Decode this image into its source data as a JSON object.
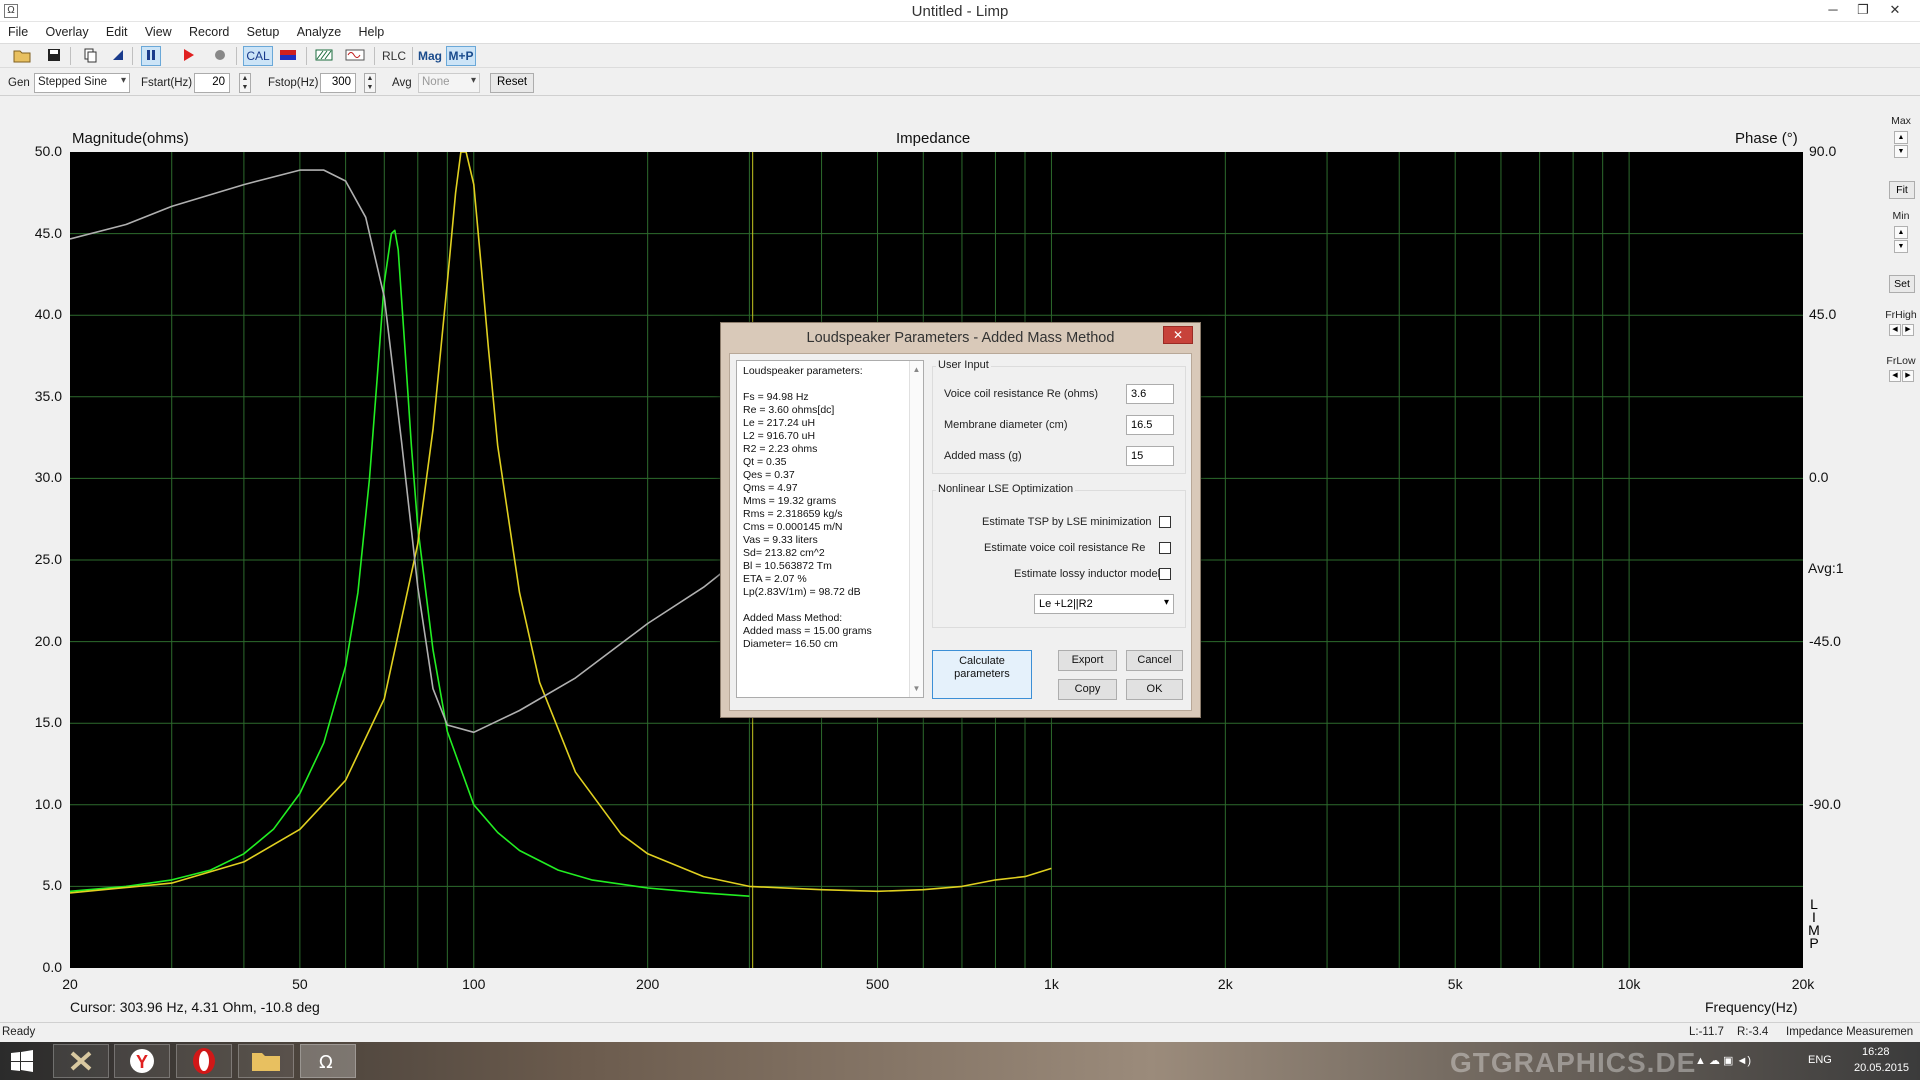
{
  "window": {
    "title": "Untitled - Limp",
    "app_icon": "Ω"
  },
  "menu": [
    "File",
    "Overlay",
    "Edit",
    "View",
    "Record",
    "Setup",
    "Analyze",
    "Help"
  ],
  "toolbar": {
    "cal": "CAL",
    "rlc": "RLC",
    "mag": "Mag",
    "mp": "M+P"
  },
  "genbar": {
    "gen_label": "Gen",
    "gen_value": "Stepped Sine",
    "fstart_label": "Fstart(Hz)",
    "fstart_value": "20",
    "fstop_label": "Fstop(Hz)",
    "fstop_value": "300",
    "avg_label": "Avg",
    "avg_value": "None",
    "reset": "Reset"
  },
  "plot": {
    "left_title": "Magnitude(ohms)",
    "center_title": "Impedance",
    "right_title": "Phase (°)",
    "x_title": "Frequency(Hz)",
    "cursor": "Cursor: 303.96 Hz, 4.31 Ohm, -10.8 deg",
    "avg": "Avg:1",
    "limp_v": [
      "L",
      "I",
      "M",
      "P"
    ]
  },
  "chart_data": {
    "type": "line",
    "title": "Impedance",
    "xlabel": "Frequency(Hz)",
    "ylabel": "Magnitude(ohms)",
    "y2label": "Phase (°)",
    "x_scale": "log",
    "xlim": [
      20,
      20000
    ],
    "ylim": [
      0,
      50
    ],
    "y2lim": [
      -135,
      90
    ],
    "grid": true,
    "x_ticks": [
      "20",
      "50",
      "100",
      "200",
      "500",
      "1k",
      "2k",
      "5k",
      "10k",
      "20k"
    ],
    "y_ticks": [
      "0.0",
      "5.0",
      "10.0",
      "15.0",
      "20.0",
      "25.0",
      "30.0",
      "35.0",
      "40.0",
      "45.0",
      "50.0"
    ],
    "y2_ticks": [
      "90.0",
      "45.0",
      "0.0",
      "-45.0",
      "-90.0"
    ],
    "cursor_x": 303.96,
    "series": [
      {
        "color": "#22ee22",
        "x": [
          20,
          25,
          30,
          35,
          40,
          45,
          50,
          55,
          60,
          63,
          66,
          68,
          70,
          72,
          73,
          74,
          76,
          78,
          80,
          85,
          90,
          100,
          110,
          120,
          140,
          160,
          200,
          250,
          300
        ],
        "y": [
          4.7,
          5.0,
          5.4,
          6.0,
          7.0,
          8.5,
          10.7,
          13.8,
          18.5,
          23.0,
          30.0,
          36.0,
          42.0,
          45.0,
          45.2,
          44.0,
          38.0,
          32.0,
          27.0,
          19.5,
          14.5,
          10.0,
          8.3,
          7.2,
          6.0,
          5.4,
          4.9,
          4.6,
          4.4
        ]
      },
      {
        "color": "#e0d020",
        "x": [
          20,
          30,
          40,
          50,
          60,
          70,
          80,
          85,
          90,
          93,
          95,
          97,
          100,
          103,
          106,
          110,
          120,
          130,
          150,
          180,
          200,
          250,
          300,
          400,
          500,
          600,
          700,
          800,
          900,
          1000
        ],
        "y": [
          4.6,
          5.2,
          6.5,
          8.5,
          11.5,
          16.5,
          26.0,
          33.0,
          42.0,
          47.5,
          50.0,
          50.0,
          48.0,
          43.0,
          38.0,
          32.0,
          23.0,
          17.5,
          12.0,
          8.2,
          7.0,
          5.6,
          5.0,
          4.8,
          4.7,
          4.8,
          5.0,
          5.4,
          5.6,
          6.1
        ]
      },
      {
        "color": "#b0b0b0",
        "x": [
          20,
          25,
          30,
          40,
          50,
          55,
          60,
          65,
          70,
          75,
          80,
          85,
          90,
          100,
          120,
          150,
          200,
          250,
          300
        ],
        "y2": [
          66,
          70,
          75,
          81,
          85,
          85,
          82,
          72,
          50,
          10,
          -30,
          -58,
          -68,
          -70,
          -64,
          -55,
          -40,
          -30,
          -20
        ]
      }
    ]
  },
  "side": {
    "max": "Max",
    "fit": "Fit",
    "min": "Min",
    "set": "Set",
    "frhigh": "FrHigh",
    "frlow": "FrLow"
  },
  "status": {
    "ready": "Ready",
    "l": "L:-11.7",
    "r": "R:-3.4",
    "mode": "Impedance Measuremen"
  },
  "taskbar": {
    "watermark": "GTGRAPHICS.DE",
    "lang": "ENG",
    "time": "16:28",
    "date": "20.05.2015"
  },
  "dialog": {
    "title": "Loudspeaker Parameters - Added Mass Method",
    "close": "✕",
    "results": [
      "Loudspeaker parameters:",
      "",
      "Fs  = 94.98 Hz",
      "Re  = 3.60 ohms[dc]",
      "Le  = 217.24 uH",
      "L2  = 916.70 uH",
      "R2  = 2.23 ohms",
      "Qt  = 0.35",
      "Qes = 0.37",
      "Qms = 4.97",
      "Mms = 19.32 grams",
      "Rms = 2.318659 kg/s",
      "Cms = 0.000145 m/N",
      "Vas = 9.33 liters",
      "Sd= 213.82 cm^2",
      "Bl  = 10.563872 Tm",
      "ETA = 2.07 %",
      "Lp(2.83V/1m) = 98.72 dB",
      "",
      "Added Mass Method:",
      "Added mass = 15.00 grams",
      "Diameter= 16.50 cm"
    ],
    "user_input": {
      "title": "User Input",
      "re_label": "Voice coil resistance Re (ohms)",
      "re_value": "3.6",
      "diam_label": "Membrane diameter (cm)",
      "diam_value": "16.5",
      "mass_label": "Added mass (g)",
      "mass_value": "15"
    },
    "nlse": {
      "title": "Nonlinear LSE Optimization",
      "opt1": "Estimate TSP by LSE minimization",
      "opt2": "Estimate voice coil resistance Re",
      "opt3": "Estimate lossy inductor model",
      "model": "Le +L2||R2"
    },
    "buttons": {
      "calc1": "Calculate",
      "calc2": "parameters",
      "export": "Export",
      "cancel": "Cancel",
      "copy": "Copy",
      "ok": "OK"
    }
  }
}
